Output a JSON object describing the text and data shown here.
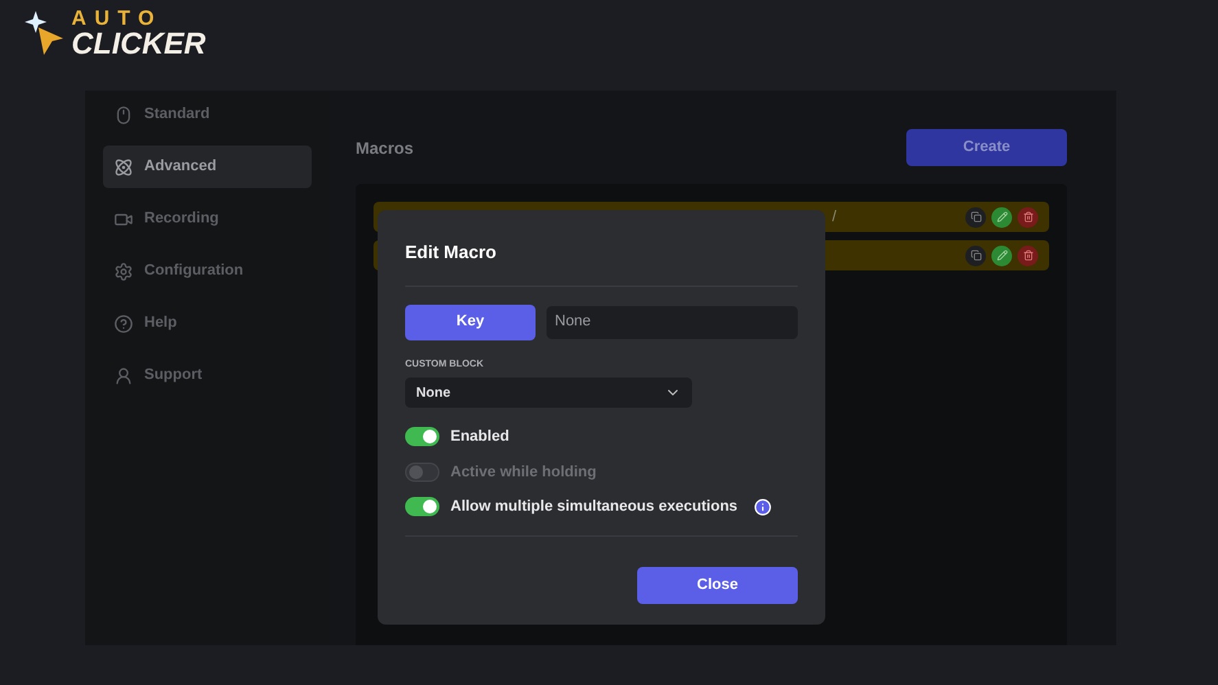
{
  "logo": {
    "line_1": "AUTO",
    "line_2": "CLICKER"
  },
  "sidebar": {
    "items": [
      {
        "label": "Standard",
        "selected": false
      },
      {
        "label": "Advanced",
        "selected": true
      },
      {
        "label": "Recording",
        "selected": false
      },
      {
        "label": "Configuration",
        "selected": false
      },
      {
        "label": "Help",
        "selected": false
      },
      {
        "label": "Support",
        "selected": false
      }
    ]
  },
  "main": {
    "title": "Macros",
    "create_button": "Create",
    "macros": [
      {
        "kind": "macro",
        "text": "/"
      },
      {
        "kind": "macro"
      }
    ]
  },
  "dialog": {
    "title": "Edit Macro",
    "key_button": "Key",
    "key_value": "None",
    "custom_block_label": "CUSTOM BLOCK",
    "custom_block_value": "None",
    "options": [
      {
        "label": "Enabled",
        "on": true,
        "disabled": false,
        "info": false
      },
      {
        "label": "Active while holding",
        "on": false,
        "disabled": true,
        "info": false
      },
      {
        "label": "Allow multiple simultaneous executions",
        "on": true,
        "disabled": false,
        "info": true
      }
    ],
    "close_button": "Close"
  }
}
